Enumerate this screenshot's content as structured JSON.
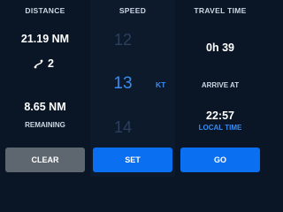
{
  "distance": {
    "header": "DISTANCE",
    "value": "21.19 NM",
    "route_icon": "route-icon",
    "waypoints": "2",
    "remaining_value": "8.65 NM",
    "remaining_label": "REMAINING"
  },
  "speed": {
    "header": "SPEED",
    "above": "12",
    "selected": "13",
    "below": "14",
    "unit": "KT"
  },
  "travel": {
    "header": "TRAVEL TIME",
    "value": "0h 39",
    "arrive_label": "ARRIVE AT",
    "arrive_value": "22:57",
    "local_label": "LOCAL TIME"
  },
  "buttons": {
    "clear": "CLEAR",
    "set": "SET",
    "go": "GO"
  },
  "colors": {
    "background": "#0a1626",
    "accent": "#0a6ff0",
    "speed_selected": "#3a8cf0",
    "clear_button": "#5e6670"
  }
}
